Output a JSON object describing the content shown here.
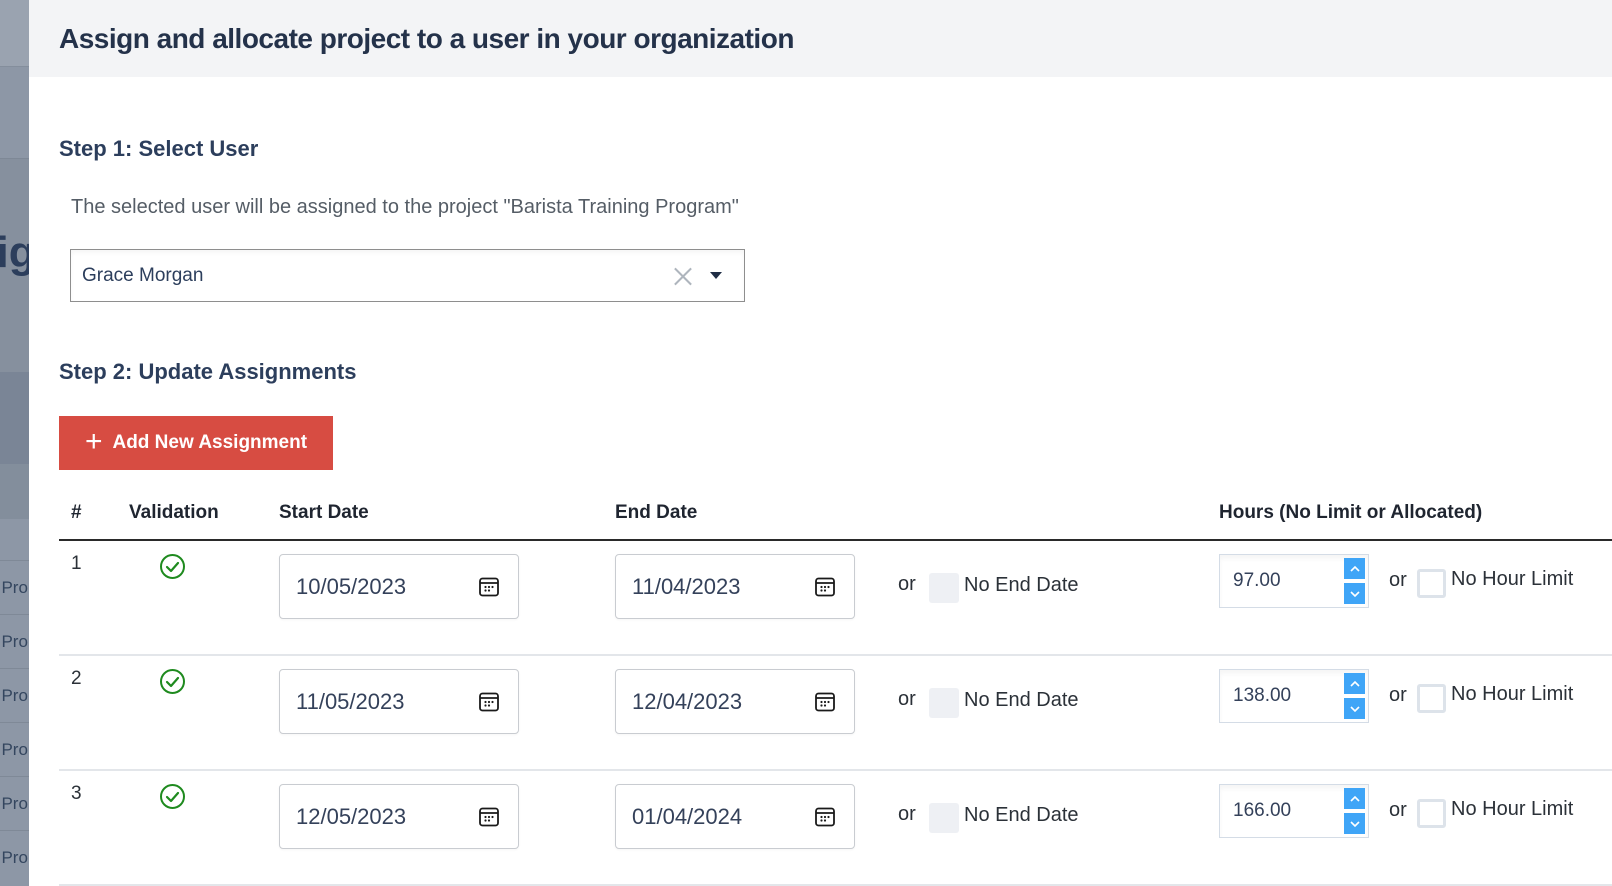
{
  "background_page": {
    "heading_fragment": "sig",
    "row_fragments": [
      "; Pro",
      "; Pro",
      "; Pro",
      "; Pro",
      "; Pro",
      "; Pro"
    ]
  },
  "panel": {
    "title": "Assign and allocate project to a user in your organization"
  },
  "step1": {
    "title": "Step 1: Select User",
    "description": "The selected user will be assigned to the project \"Barista Training Program\"",
    "user_select": {
      "value": "Grace Morgan",
      "clear_icon": "close-icon",
      "dropdown_icon": "caret-down-icon"
    }
  },
  "step2": {
    "title": "Step 2: Update Assignments",
    "add_button": {
      "icon": "plus-icon",
      "label": "Add New Assignment",
      "color": "#d74c42"
    },
    "table": {
      "headers": {
        "num": "#",
        "validation": "Validation",
        "start_date": "Start Date",
        "end_date": "End Date",
        "hours": "Hours (No Limit or Allocated)"
      },
      "rows": [
        {
          "num": "1",
          "valid": true,
          "start_date": "10/05/2023",
          "end_date": "11/04/2023",
          "or1": "or",
          "no_end_date_label": "No End Date",
          "no_end_date_checked": false,
          "hours": "97.00",
          "or2": "or",
          "no_hour_limit_label": "No Hour Limit",
          "no_hour_limit_checked": false
        },
        {
          "num": "2",
          "valid": true,
          "start_date": "11/05/2023",
          "end_date": "12/04/2023",
          "or1": "or",
          "no_end_date_label": "No End Date",
          "no_end_date_checked": false,
          "hours": "138.00",
          "or2": "or",
          "no_hour_limit_label": "No Hour Limit",
          "no_hour_limit_checked": false
        },
        {
          "num": "3",
          "valid": true,
          "start_date": "12/05/2023",
          "end_date": "01/04/2024",
          "or1": "or",
          "no_end_date_label": "No End Date",
          "no_end_date_checked": false,
          "hours": "166.00",
          "or2": "or",
          "no_hour_limit_label": "No Hour Limit",
          "no_hour_limit_checked": false
        }
      ]
    }
  },
  "colors": {
    "valid_check": "#1e8a1e",
    "spinner": "#3fa5f7",
    "header_bg": "#f3f4f6",
    "title_text": "#24324a"
  }
}
